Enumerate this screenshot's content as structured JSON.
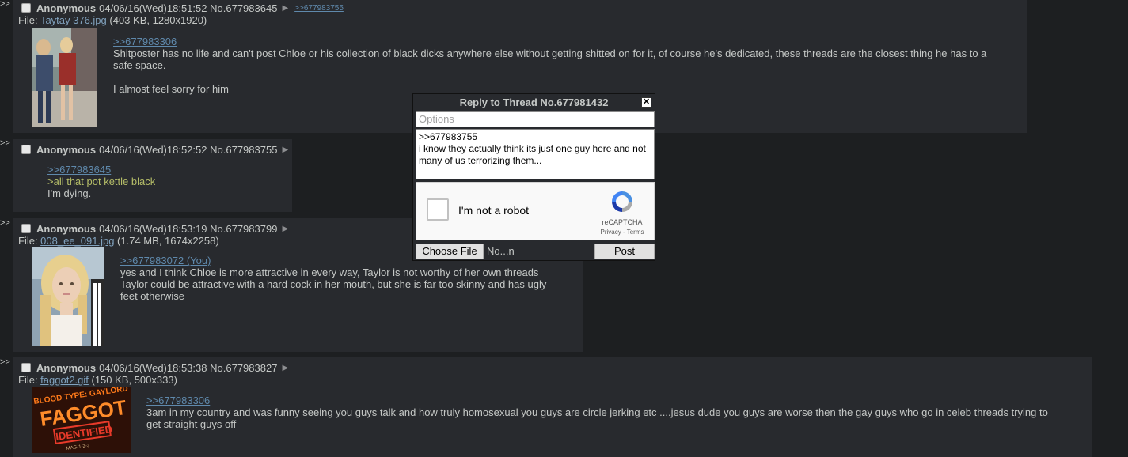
{
  "posts": [
    {
      "name": "Anonymous",
      "datetime": "04/06/16(Wed)18:51:52",
      "number": "No.677983645",
      "backlink": ">>677983755",
      "file_prefix": "File: ",
      "file_name": "Taytay 376.jpg",
      "file_meta": " (403 KB, 1280x1920)",
      "quote": ">>677983306",
      "lines": [
        "Shitposter has no life and can't post Chloe or his collection of black dicks anywhere else without getting shitted on for it, of course he's dedicated, these threads are the closest thing he has to a safe space.",
        "I almost feel sorry for him"
      ]
    },
    {
      "name": "Anonymous",
      "datetime": "04/06/16(Wed)18:52:52",
      "number": "No.677983755",
      "quote": ">>677983645",
      "greentext": ">all that pot kettle black",
      "lines": [
        "I'm dying."
      ]
    },
    {
      "name": "Anonymous",
      "datetime": "04/06/16(Wed)18:53:19",
      "number": "No.677983799",
      "file_prefix": "File: ",
      "file_name": "008_ee_091.jpg",
      "file_meta": " (1.74 MB, 1674x2258)",
      "quote": ">>677983072 (You)",
      "lines": [
        "yes and I think Chloe is more attractive in every way, Taylor is not worthy of her own threads",
        "Taylor could be attractive with a hard cock in her mouth, but she is far too skinny and has ugly feet otherwise"
      ]
    },
    {
      "name": "Anonymous",
      "datetime": "04/06/16(Wed)18:53:38",
      "number": "No.677983827",
      "file_prefix": "File: ",
      "file_name": "faggot2.gif",
      "file_meta": " (150 KB, 500x333)",
      "quote": ">>677983306",
      "lines": [
        "3am in my country and was funny seeing you guys talk and how truly homosexual you guys are circle jerking etc ....jesus dude you guys are worse then the gay guys who go in celeb threads trying to get straight guys off"
      ],
      "thumb_text": {
        "top": "BLOOD TYPE: GAYLORD",
        "main": "FAGGOT",
        "stamp": "IDENTIFIED",
        "small": "MAG-1-2-3"
      }
    }
  ],
  "side_arrow": ">>",
  "menu_arrow": "▶",
  "quick_reply": {
    "title": "Reply to Thread No.677981432",
    "close": "✕",
    "options_placeholder": "Options",
    "comment": ">>677983755\ni know they actually think its just one guy here and not many of us terrorizing them...",
    "captcha_label": "I'm not a robot",
    "captcha_brand": "reCAPTCHA",
    "captcha_links": "Privacy - Terms",
    "choose_file": "Choose File",
    "file_name": "No...n",
    "post": "Post"
  }
}
